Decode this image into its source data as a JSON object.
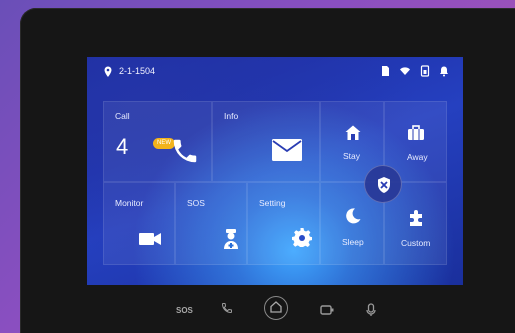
{
  "status": {
    "location": "2-1-1504"
  },
  "tiles": {
    "call": {
      "label": "Call",
      "count": "4",
      "badge": "NEW"
    },
    "info": {
      "label": "Info"
    },
    "stay": {
      "label": "Stay"
    },
    "away": {
      "label": "Away"
    },
    "monitor": {
      "label": "Monitor"
    },
    "sos": {
      "label": "SOS"
    },
    "setting": {
      "label": "Setting"
    },
    "sleep": {
      "label": "Sleep"
    },
    "custom": {
      "label": "Custom"
    }
  },
  "hardware": {
    "sos_label": "SOS"
  },
  "colors": {
    "accent_badge": "#f2b31b",
    "screen_blue": "#1c2a9e"
  }
}
